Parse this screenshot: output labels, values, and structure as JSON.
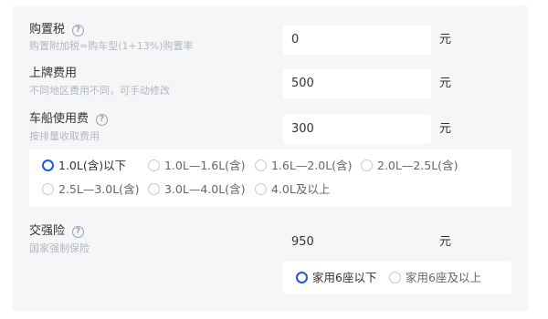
{
  "purchase_tax": {
    "label": "购置税",
    "hint": "购置附加税=购车型(1+13%)购置率",
    "value": "0",
    "unit": "元"
  },
  "license_fee": {
    "label": "上牌费用",
    "hint": "不同地区费用不同，可手动修改",
    "value": "500",
    "unit": "元"
  },
  "vessel_tax": {
    "label": "车船使用费",
    "hint": "按排量收取费用",
    "value": "300",
    "unit": "元",
    "options": [
      "1.0L(含)以下",
      "1.0L—1.6L(含)",
      "1.6L—2.0L(含)",
      "2.0L—2.5L(含)",
      "2.5L—3.0L(含)",
      "3.0L—4.0L(含)",
      "4.0L及以上"
    ],
    "selected": "1.0L(含)以下"
  },
  "compulsory_insurance": {
    "label": "交强险",
    "hint": "国家强制保险",
    "value": "950",
    "unit": "元",
    "options": [
      "家用6座以下",
      "家用6座及以上"
    ],
    "selected": "家用6座以下"
  },
  "help_icon_glyph": "?",
  "accent_color": "#1f5bd6"
}
